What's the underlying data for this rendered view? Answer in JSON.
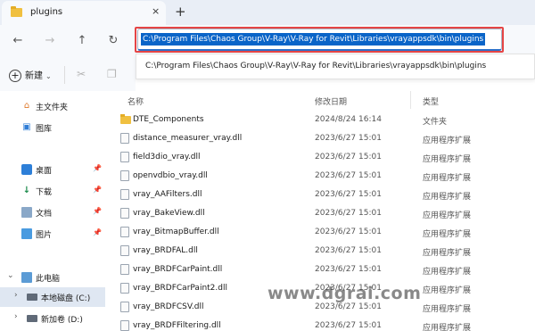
{
  "tab": {
    "title": "plugins",
    "close_glyph": "×",
    "new_tab_glyph": "+"
  },
  "nav": {
    "back_glyph": "←",
    "forward_glyph": "→",
    "up_glyph": "↑",
    "refresh_glyph": "↻",
    "address": "C:\\Program Files\\Chaos Group\\V-Ray\\V-Ray for Revit\\Libraries\\vrayappsdk\\bin\\plugins"
  },
  "suggestion": "C:\\Program Files\\Chaos Group\\V-Ray\\V-Ray for Revit\\Libraries\\vrayappsdk\\bin\\plugins",
  "toolbar": {
    "new_label": "新建",
    "new_caret": "⌄",
    "cut_glyph": "✂",
    "copy_glyph": "❐"
  },
  "sidebar": {
    "home": "主文件夹",
    "gallery": "图库",
    "desktop": "桌面",
    "downloads": "下载",
    "documents": "文档",
    "pictures": "图片",
    "this_pc": "此电脑",
    "local_disk": "本地磁盘 (C:)",
    "new_volume": "新加卷 (D:)",
    "pin_glyph": "📌",
    "expand_glyph": "›",
    "expanded_glyph": "⌄"
  },
  "columns": {
    "name": "名称",
    "modified": "修改日期",
    "type": "类型"
  },
  "files": [
    {
      "name": "DTE_Components",
      "date": "2024/8/24 16:14",
      "type": "文件夹",
      "is_folder": true
    },
    {
      "name": "distance_measurer_vray.dll",
      "date": "2023/6/27 15:01",
      "type": "应用程序扩展"
    },
    {
      "name": "field3dio_vray.dll",
      "date": "2023/6/27 15:01",
      "type": "应用程序扩展"
    },
    {
      "name": "openvdbio_vray.dll",
      "date": "2023/6/27 15:01",
      "type": "应用程序扩展"
    },
    {
      "name": "vray_AAFilters.dll",
      "date": "2023/6/27 15:01",
      "type": "应用程序扩展"
    },
    {
      "name": "vray_BakeView.dll",
      "date": "2023/6/27 15:01",
      "type": "应用程序扩展"
    },
    {
      "name": "vray_BitmapBuffer.dll",
      "date": "2023/6/27 15:01",
      "type": "应用程序扩展"
    },
    {
      "name": "vray_BRDFAL.dll",
      "date": "2023/6/27 15:01",
      "type": "应用程序扩展"
    },
    {
      "name": "vray_BRDFCarPaint.dll",
      "date": "2023/6/27 15:01",
      "type": "应用程序扩展"
    },
    {
      "name": "vray_BRDFCarPaint2.dll",
      "date": "2023/6/27 15:01",
      "type": "应用程序扩展"
    },
    {
      "name": "vray_BRDFCSV.dll",
      "date": "2023/6/27 15:01",
      "type": "应用程序扩展"
    },
    {
      "name": "vray_BRDFFiltering.dll",
      "date": "2023/6/27 15:01",
      "type": "应用程序扩展"
    }
  ],
  "watermark": "www.dgrai.com"
}
